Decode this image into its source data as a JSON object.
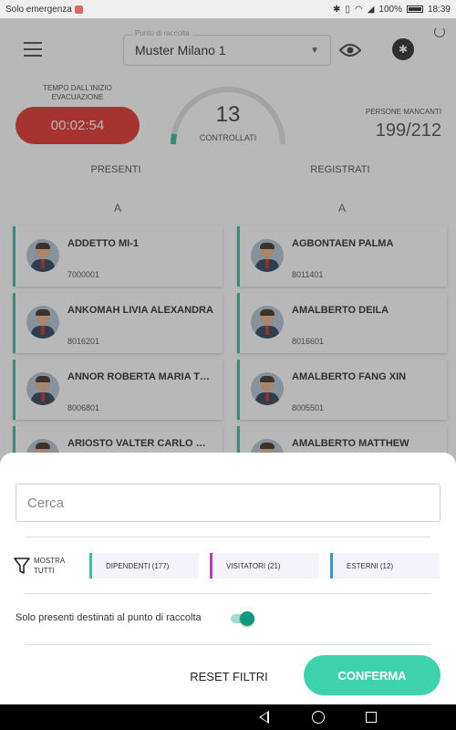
{
  "status_bar": {
    "left_text": "Solo emergenza",
    "battery": "100%",
    "time": "18:39",
    "icons": [
      "sim-icon",
      "bluetooth-icon",
      "vibrate-icon",
      "wifi-icon",
      "signal-icon",
      "battery-icon"
    ]
  },
  "header": {
    "muster_hint": "Punto di raccolta",
    "muster_value": "Muster Milano 1",
    "icons": [
      "menu-icon",
      "eye-icon",
      "bluetooth-icon",
      "sync-icon"
    ]
  },
  "stats": {
    "elapsed_title": "TEMPO DALL'INIZIO EVACUAZIONE",
    "timer": "00:02:54",
    "checked_count": "13",
    "checked_label": "CONTROLLATI",
    "checked_fraction": 0.06,
    "missing_title": "PERSONE MANCANTI",
    "missing_count": "199/212"
  },
  "tabs": {
    "present": "PRESENTI",
    "registered": "REGISTRATI"
  },
  "present_list": {
    "letter": "A",
    "items": [
      {
        "name": "ADDETTO MI-1",
        "code": "7000001"
      },
      {
        "name": "ANKOMAH LIVIA ALEXANDRA",
        "code": "8016201"
      },
      {
        "name": "ANNOR ROBERTA MARIA TERESA",
        "code": "8006801"
      },
      {
        "name": "ARIOSTO VALTER CARLO ORAZIO",
        "code": ""
      }
    ]
  },
  "registered_list": {
    "letter": "A",
    "items": [
      {
        "name": "AGBONTAEN PALMA",
        "code": "8011401"
      },
      {
        "name": "AMALBERTO DEILA",
        "code": "8016601"
      },
      {
        "name": "AMALBERTO FANG XIN",
        "code": "8005501"
      },
      {
        "name": "AMALBERTO MATTHEW",
        "code": ""
      }
    ]
  },
  "filter_sheet": {
    "search_placeholder": "Cerca",
    "show_all": "MOSTRA TUTTI",
    "chips": [
      {
        "label": "DIPENDENTI (177)",
        "color": "#3dbea0"
      },
      {
        "label": "VISITATORI (21)",
        "color": "#b93bbf"
      },
      {
        "label": "ESTERNI (12)",
        "color": "#2e9bd6"
      }
    ],
    "toggle_label": "Solo presenti destinati al punto di raccolta",
    "toggle_on": true,
    "reset_label": "RESET FILTRI",
    "confirm_label": "CONFERMA"
  },
  "colors": {
    "accent": "#3dd1ac",
    "timer_red": "#e53935",
    "toggle_on": "#0f9a7e"
  }
}
